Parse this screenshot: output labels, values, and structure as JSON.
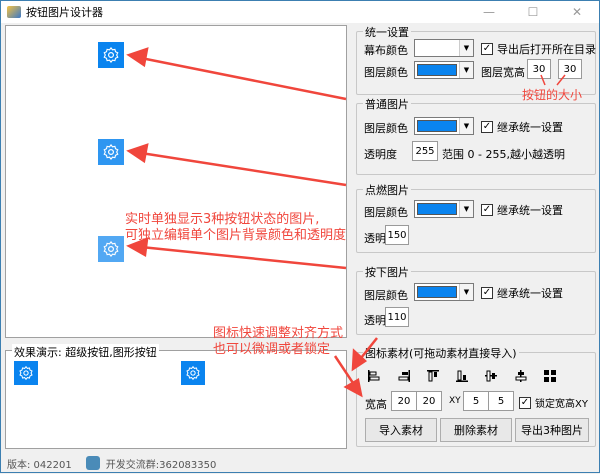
{
  "window": {
    "title": "按钮图片设计器",
    "minimize": "—",
    "maximize": "☐",
    "close": "✕"
  },
  "unified": {
    "legend": "统一设置",
    "canvas_color_label": "幕布颜色",
    "canvas_color": "#ffffff",
    "layer_color_label": "图层颜色",
    "layer_color": "#0a84ef",
    "open_dir_label": "导出后打开所在目录",
    "open_dir_checked": true,
    "size_label": "图层宽高",
    "width": "30",
    "height": "30"
  },
  "normal": {
    "legend": "普通图片",
    "layer_color_label": "图层颜色",
    "layer_color": "#0a84ef",
    "inherit_label": "继承统一设置",
    "inherit_checked": true,
    "opacity_label": "透明度",
    "opacity": "255",
    "range_hint": "范围 0 - 255,越小越透明"
  },
  "hover": {
    "legend": "点燃图片",
    "layer_color_label": "图层颜色",
    "inherit_label": "继承统一设置",
    "opacity_label": "透明度",
    "opacity": "150"
  },
  "pressed": {
    "legend": "按下图片",
    "layer_color_label": "图层颜色",
    "inherit_label": "继承统一设置",
    "opacity_label": "透明度",
    "opacity": "110"
  },
  "assets": {
    "legend": "图标素材(可拖动素材直接导入)",
    "align_icons": [
      "align-left-icon",
      "align-right-icon",
      "align-top-icon",
      "align-bottom-icon",
      "align-hcenter-icon",
      "align-vcenter-icon",
      "grid-icon"
    ],
    "size_label": "宽高",
    "w": "20",
    "h": "20",
    "xy_label": "XY",
    "x": "5",
    "y": "5",
    "lock_label": "锁定宽高XY",
    "lock_checked": true,
    "import_btn": "导入素材",
    "delete_btn": "删除素材",
    "export_btn": "导出3种图片"
  },
  "demo": {
    "legend": "效果演示: 超级按钮,图形按钮"
  },
  "status": {
    "version": "版本: 042201",
    "group": "开发交流群:362083350"
  },
  "annotations": {
    "size": "按钮的大小",
    "states_line1": "实时单独显示3种按钮状态的图片,",
    "states_line2": "可独立编辑单个图片背景颜色和透明度",
    "align_line1": "图标快速调整对齐方式",
    "align_line2": "也可以微调或者锁定"
  }
}
